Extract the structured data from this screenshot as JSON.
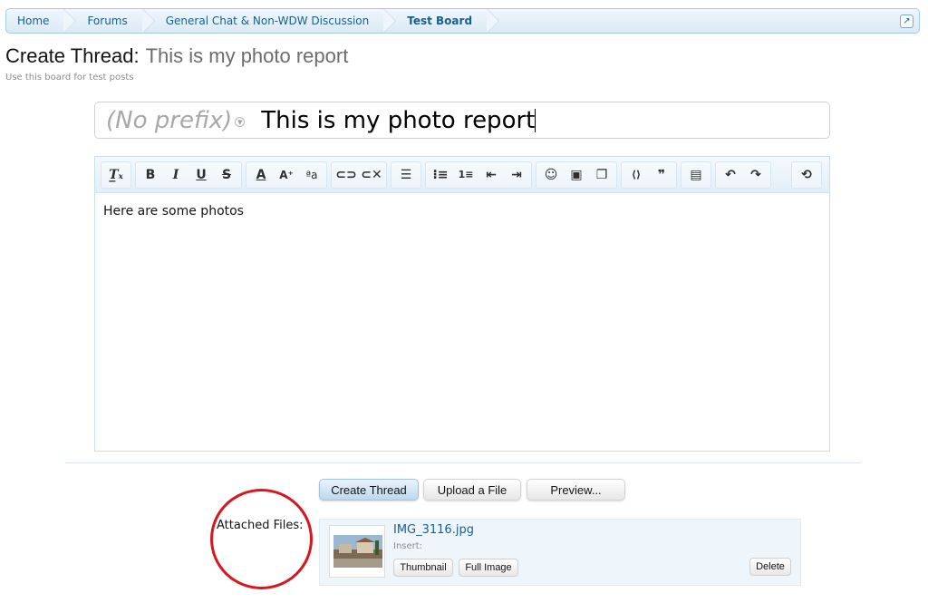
{
  "breadcrumb": {
    "items": [
      "Home",
      "Forums",
      "General Chat & Non-WDW Discussion",
      "Test Board"
    ],
    "jump_icon": "popout-arrow-icon"
  },
  "page": {
    "title_label": "Create Thread:",
    "title_name": "This is my photo report",
    "subtitle": "Use this board for test posts"
  },
  "title_field": {
    "prefix": "(No prefix)",
    "value": "This is my photo report"
  },
  "editor": {
    "content": "Here are some photos",
    "toolbar_groups": [
      [
        "remove-format-icon",
        "bold-icon",
        "italic-icon",
        "underline-icon",
        "strikethrough-icon"
      ],
      [
        "text-color-icon",
        "font-size-icon",
        "font-family-icon"
      ],
      [
        "link-icon",
        "unlink-icon"
      ],
      [
        "align-icon"
      ],
      [
        "bullet-list-icon",
        "numbered-list-icon",
        "outdent-icon",
        "indent-icon"
      ],
      [
        "smiley-icon",
        "image-icon",
        "media-icon"
      ],
      [
        "code-icon",
        "quote-icon"
      ],
      [
        "save-draft-icon"
      ],
      [
        "undo-icon",
        "redo-icon"
      ],
      [
        "toggle-bbcode-icon"
      ]
    ]
  },
  "actions": {
    "create_thread": "Create Thread",
    "upload": "Upload a File",
    "preview": "Preview..."
  },
  "attachments": {
    "label": "Attached Files:",
    "highlight_color": "#d8161f",
    "file": {
      "name": "IMG_3116.jpg",
      "insert_label": "Insert:",
      "thumbnail_button": "Thumbnail",
      "full_image_button": "Full Image",
      "delete_button": "Delete"
    }
  }
}
